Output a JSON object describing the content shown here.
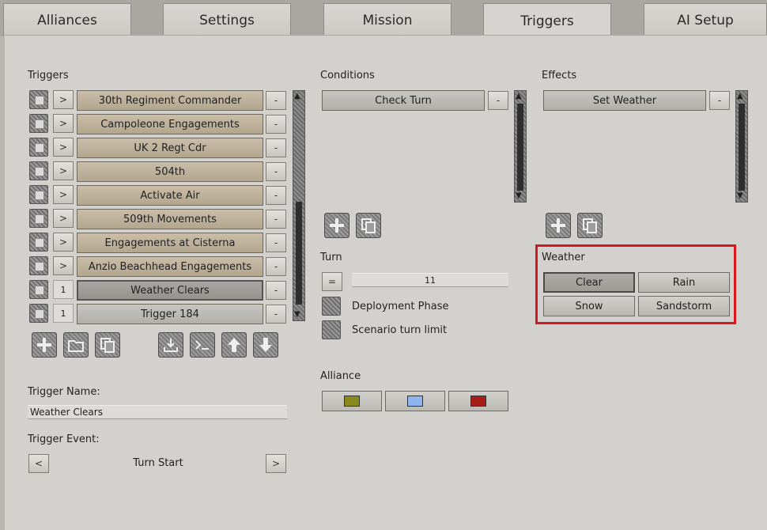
{
  "tabs": [
    {
      "label": "Alliances"
    },
    {
      "label": "Settings"
    },
    {
      "label": "Mission"
    },
    {
      "label": "Triggers"
    },
    {
      "label": "AI Setup"
    }
  ],
  "triggers": {
    "heading": "Triggers",
    "items": [
      {
        "prefix": ">",
        "label": "30th Regiment Commander"
      },
      {
        "prefix": ">",
        "label": "Campoleone Engagements"
      },
      {
        "prefix": ">",
        "label": "UK 2 Regt Cdr"
      },
      {
        "prefix": ">",
        "label": "504th"
      },
      {
        "prefix": ">",
        "label": "Activate Air"
      },
      {
        "prefix": ">",
        "label": "509th Movements"
      },
      {
        "prefix": ">",
        "label": "Engagements at Cisterna"
      },
      {
        "prefix": ">",
        "label": "Anzio Beachhead Engagements"
      },
      {
        "prefix": "1",
        "label": "Weather Clears"
      },
      {
        "prefix": "1",
        "label": "Trigger 184"
      }
    ],
    "remove_label": "-",
    "name_label": "Trigger Name:",
    "name_value": "Weather Clears",
    "event_label": "Trigger Event:",
    "event_value": "Turn Start",
    "prev_label": "<",
    "next_label": ">"
  },
  "conditions": {
    "heading": "Conditions",
    "items": [
      {
        "label": "Check Turn"
      }
    ],
    "remove_label": "-"
  },
  "turn": {
    "heading": "Turn",
    "operator": "=",
    "value": "11",
    "options": [
      {
        "label": "Deployment Phase"
      },
      {
        "label": "Scenario turn limit"
      }
    ]
  },
  "alliance": {
    "heading": "Alliance",
    "colors": [
      "#8a8a1c",
      "#8fb5f0",
      "#a61e17"
    ]
  },
  "effects": {
    "heading": "Effects",
    "items": [
      {
        "label": "Set Weather"
      }
    ],
    "remove_label": "-"
  },
  "weather": {
    "heading": "Weather",
    "options": [
      {
        "label": "Clear",
        "selected": true
      },
      {
        "label": "Rain"
      },
      {
        "label": "Snow"
      },
      {
        "label": "Sandstorm"
      }
    ],
    "highlight_color": "#d8191c"
  }
}
